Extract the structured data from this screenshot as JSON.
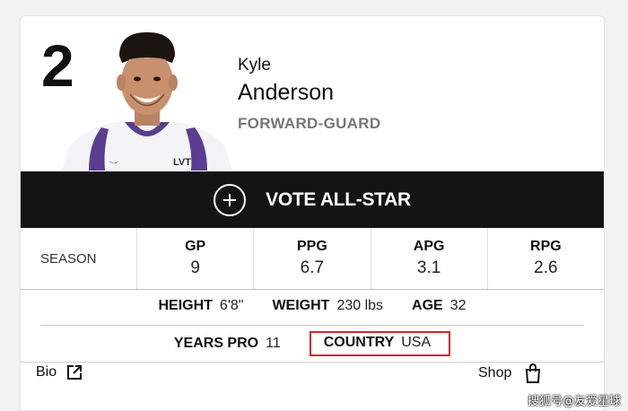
{
  "player": {
    "number": "2",
    "first_name": "Kyle",
    "last_name": "Anderson",
    "position": "FORWARD-GUARD",
    "jersey_text": "LVT"
  },
  "vote": {
    "label": "VOTE ALL-STAR",
    "icon": "plus-circle-icon"
  },
  "stats": {
    "season_label": "SEASON",
    "columns": [
      {
        "label": "GP",
        "value": "9"
      },
      {
        "label": "PPG",
        "value": "6.7"
      },
      {
        "label": "APG",
        "value": "3.1"
      },
      {
        "label": "RPG",
        "value": "2.6"
      }
    ]
  },
  "info": {
    "height_label": "HEIGHT",
    "height_value": "6'8\"",
    "weight_label": "WEIGHT",
    "weight_value": "230 lbs",
    "age_label": "AGE",
    "age_value": "32",
    "years_label": "YEARS PRO",
    "years_value": "11",
    "country_label": "COUNTRY",
    "country_value": "USA"
  },
  "footer": {
    "bio_label": "Bio",
    "shop_label": "Shop"
  },
  "watermark": "搜狐号@友爱星球",
  "colors": {
    "vote_bar": "#141414",
    "highlight_box": "#d32626",
    "jersey_purple": "#5a3d91"
  }
}
